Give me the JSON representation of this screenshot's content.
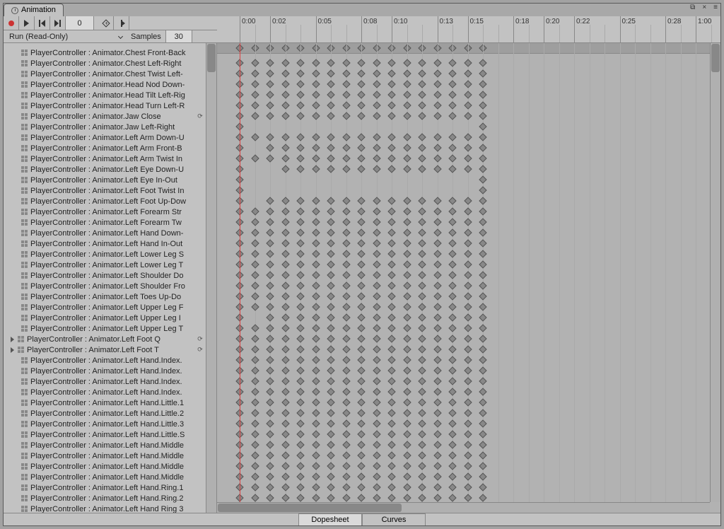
{
  "tab_title": "Animation",
  "toolbar": {
    "frame_value": "0"
  },
  "clip": {
    "name": "Run (Read-Only)",
    "samples_label": "Samples",
    "samples_value": "30"
  },
  "ruler_labels": [
    "0:00",
    "0:02",
    "0:05",
    "0:08",
    "0:10",
    "0:13",
    "0:15",
    "0:18",
    "0:20",
    "0:22",
    "0:25",
    "0:28",
    "1:00"
  ],
  "footer": {
    "dopesheet": "Dopesheet",
    "curves": "Curves"
  },
  "properties": [
    {
      "label": "PlayerController : Animator.Chest Front-Back",
      "kind": "prop"
    },
    {
      "label": "PlayerController : Animator.Chest Left-Right",
      "kind": "prop"
    },
    {
      "label": "PlayerController : Animator.Chest Twist Left-",
      "kind": "prop"
    },
    {
      "label": "PlayerController : Animator.Head Nod Down-",
      "kind": "prop"
    },
    {
      "label": "PlayerController : Animator.Head Tilt Left-Rig",
      "kind": "prop"
    },
    {
      "label": "PlayerController : Animator.Head Turn Left-R",
      "kind": "prop"
    },
    {
      "label": "PlayerController : Animator.Jaw Close",
      "kind": "prop",
      "loop": true
    },
    {
      "label": "PlayerController : Animator.Jaw Left-Right",
      "kind": "prop"
    },
    {
      "label": "PlayerController : Animator.Left Arm Down-U",
      "kind": "prop"
    },
    {
      "label": "PlayerController : Animator.Left Arm Front-B",
      "kind": "prop"
    },
    {
      "label": "PlayerController : Animator.Left Arm Twist In",
      "kind": "prop"
    },
    {
      "label": "PlayerController : Animator.Left Eye Down-U",
      "kind": "prop"
    },
    {
      "label": "PlayerController : Animator.Left Eye In-Out",
      "kind": "prop"
    },
    {
      "label": "PlayerController : Animator.Left Foot Twist In",
      "kind": "prop"
    },
    {
      "label": "PlayerController : Animator.Left Foot Up-Dow",
      "kind": "prop"
    },
    {
      "label": "PlayerController : Animator.Left Forearm Str",
      "kind": "prop"
    },
    {
      "label": "PlayerController : Animator.Left Forearm Tw",
      "kind": "prop"
    },
    {
      "label": "PlayerController : Animator.Left Hand Down-",
      "kind": "prop"
    },
    {
      "label": "PlayerController : Animator.Left Hand In-Out",
      "kind": "prop"
    },
    {
      "label": "PlayerController : Animator.Left Lower Leg S",
      "kind": "prop"
    },
    {
      "label": "PlayerController : Animator.Left Lower Leg T",
      "kind": "prop"
    },
    {
      "label": "PlayerController : Animator.Left Shoulder Do",
      "kind": "prop"
    },
    {
      "label": "PlayerController : Animator.Left Shoulder Fro",
      "kind": "prop"
    },
    {
      "label": "PlayerController : Animator.Left Toes Up-Do",
      "kind": "prop"
    },
    {
      "label": "PlayerController : Animator.Left Upper Leg F",
      "kind": "prop"
    },
    {
      "label": "PlayerController : Animator.Left Upper Leg I",
      "kind": "prop"
    },
    {
      "label": "PlayerController : Animator.Left Upper Leg T",
      "kind": "prop"
    },
    {
      "label": "PlayerController : Animator.Left Foot Q",
      "kind": "fold",
      "loop": true
    },
    {
      "label": "PlayerController : Animator.Left Foot T",
      "kind": "fold",
      "loop": true
    },
    {
      "label": "PlayerController : Animator.Left Hand.Index.",
      "kind": "prop"
    },
    {
      "label": "PlayerController : Animator.Left Hand.Index.",
      "kind": "prop"
    },
    {
      "label": "PlayerController : Animator.Left Hand.Index.",
      "kind": "prop"
    },
    {
      "label": "PlayerController : Animator.Left Hand.Index.",
      "kind": "prop"
    },
    {
      "label": "PlayerController : Animator.Left Hand.Little.1",
      "kind": "prop"
    },
    {
      "label": "PlayerController : Animator.Left Hand.Little.2",
      "kind": "prop"
    },
    {
      "label": "PlayerController : Animator.Left Hand.Little.3",
      "kind": "prop"
    },
    {
      "label": "PlayerController : Animator.Left Hand.Little.S",
      "kind": "prop"
    },
    {
      "label": "PlayerController : Animator.Left Hand.Middle",
      "kind": "prop"
    },
    {
      "label": "PlayerController : Animator.Left Hand.Middle",
      "kind": "prop"
    },
    {
      "label": "PlayerController : Animator.Left Hand.Middle",
      "kind": "prop"
    },
    {
      "label": "PlayerController : Animator.Left Hand.Middle",
      "kind": "prop"
    },
    {
      "label": "PlayerController : Animator.Left Hand.Ring.1",
      "kind": "prop"
    },
    {
      "label": "PlayerController : Animator.Left Hand.Ring.2",
      "kind": "prop"
    },
    {
      "label": "PlayerController : Animator.Left Hand Ring 3",
      "kind": "prop"
    }
  ],
  "key_patterns": {
    "full": [
      0,
      1,
      2,
      3,
      4,
      5,
      6,
      7,
      8,
      9,
      10,
      11,
      12,
      13,
      14,
      15,
      16
    ],
    "end": [
      0,
      16
    ],
    "skip1": [
      0,
      2,
      3,
      4,
      5,
      6,
      7,
      8,
      9,
      10,
      11,
      12,
      13,
      14,
      15,
      16
    ],
    "skip2": [
      0,
      3,
      4,
      5,
      6,
      7,
      8,
      9,
      10,
      11,
      12,
      13,
      14,
      15,
      16
    ]
  },
  "row_pattern_map": [
    "full",
    "full",
    "full",
    "full",
    "full",
    "full",
    "end",
    "full",
    "skip1",
    "full",
    "skip2",
    "end",
    "end",
    "skip1",
    "full",
    "full",
    "full",
    "full",
    "full",
    "full",
    "full",
    "full",
    "full",
    "full",
    "skip1",
    "full",
    "full",
    "full",
    "full",
    "full",
    "full",
    "full",
    "full",
    "full",
    "full",
    "full",
    "full",
    "full",
    "full",
    "full",
    "full",
    "full",
    "full",
    "full"
  ]
}
